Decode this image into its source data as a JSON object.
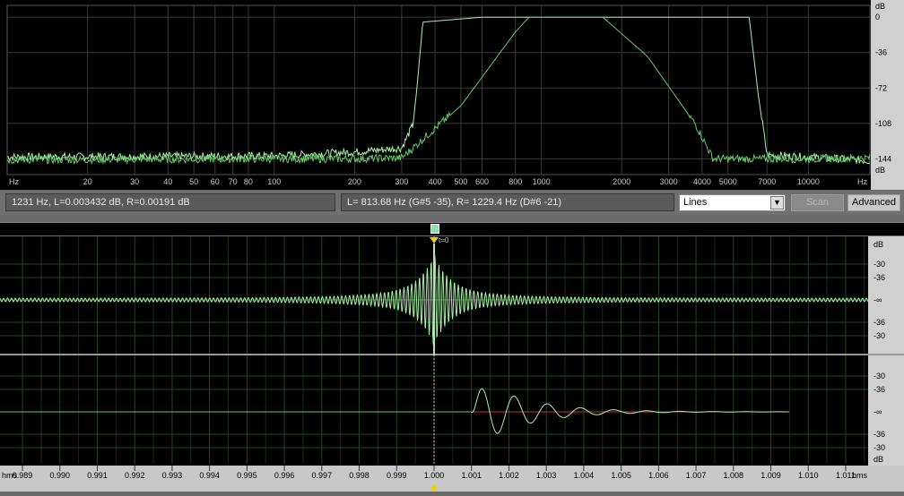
{
  "colors": {
    "background": "#000000",
    "grid": "#3a3a3a",
    "wave_grid": "#1e4a1e",
    "trace": "#a8f0a8",
    "trace_dim": "#66c866",
    "axis_panel": "#d0d0d0",
    "marker": "#f0d000",
    "red_line": "#c83030"
  },
  "spectrum": {
    "x_unit_left": "Hz",
    "x_unit_right": "Hz",
    "y_unit": "dB",
    "x_ticks": [
      {
        "label": "20",
        "v": 20
      },
      {
        "label": "30",
        "v": 30
      },
      {
        "label": "40",
        "v": 40
      },
      {
        "label": "50",
        "v": 50
      },
      {
        "label": "60",
        "v": 60
      },
      {
        "label": "70",
        "v": 70
      },
      {
        "label": "80",
        "v": 80
      },
      {
        "label": "100",
        "v": 100
      },
      {
        "label": "200",
        "v": 200
      },
      {
        "label": "300",
        "v": 300
      },
      {
        "label": "400",
        "v": 400
      },
      {
        "label": "500",
        "v": 500
      },
      {
        "label": "600",
        "v": 600
      },
      {
        "label": "800",
        "v": 800
      },
      {
        "label": "1000",
        "v": 1000
      },
      {
        "label": "2000",
        "v": 2000
      },
      {
        "label": "3000",
        "v": 3000
      },
      {
        "label": "4000",
        "v": 4000
      },
      {
        "label": "5000",
        "v": 5000
      },
      {
        "label": "7000",
        "v": 7000
      },
      {
        "label": "10000",
        "v": 10000
      }
    ],
    "y_ticks": [
      {
        "label": "0",
        "v": 0
      },
      {
        "label": "-36",
        "v": -36
      },
      {
        "label": "-72",
        "v": -72
      },
      {
        "label": "-108",
        "v": -108
      },
      {
        "label": "-144",
        "v": -144
      }
    ]
  },
  "chart_data": [
    {
      "type": "line",
      "xscale": "log",
      "xlim": [
        10,
        17000
      ],
      "ylim": [
        -160,
        12
      ],
      "xlabel": "Hz",
      "ylabel": "dB",
      "series": [
        {
          "values": [
            [
              10,
              -142
            ],
            [
              100,
              -141
            ],
            [
              200,
              -137
            ],
            [
              300,
              -133
            ],
            [
              330,
              -110
            ],
            [
              340,
              -80
            ],
            [
              360,
              -5
            ],
            [
              600,
              0
            ],
            [
              1500,
              0
            ],
            [
              6000,
              0
            ],
            [
              6500,
              -80
            ],
            [
              7000,
              -140
            ],
            [
              10000,
              -142
            ],
            [
              17000,
              -146
            ]
          ]
        },
        {
          "values": [
            [
              10,
              -145
            ],
            [
              100,
              -144
            ],
            [
              200,
              -144
            ],
            [
              300,
              -143
            ],
            [
              500,
              -90
            ],
            [
              800,
              -15
            ],
            [
              900,
              0
            ],
            [
              1700,
              0
            ],
            [
              2500,
              -40
            ],
            [
              3800,
              -110
            ],
            [
              4400,
              -144
            ],
            [
              10000,
              -144
            ],
            [
              17000,
              -143
            ]
          ]
        }
      ]
    },
    {
      "type": "line",
      "xlim": [
        0.9884,
        1.0116
      ],
      "xlabel": "hms",
      "ylabel": "dB"
    }
  ],
  "status": {
    "cursor": "1231 Hz, L=0.003432 dB, R=0.00191 dB",
    "markers": "L= 813.68 Hz (G#5 -35), R= 1229.4 Hz (D#6 -21)",
    "mode_value": "Lines",
    "scan_label": "Scan",
    "advanced_label": "Advanced"
  },
  "waveform": {
    "marker_label": "t=0",
    "y_unit": "dB",
    "x_unit_left": "hms",
    "x_unit_right": "hms",
    "y_ticks_top": [
      "-30",
      "-36",
      "-∞",
      "-36",
      "-30"
    ],
    "y_ticks_bottom": [
      "-30",
      "-36",
      "-∞",
      "-36",
      "-30"
    ],
    "bottom_unit": "dB",
    "x_ticks": [
      "0.989",
      "0.990",
      "0.991",
      "0.992",
      "0.993",
      "0.994",
      "0.995",
      "0.996",
      "0.997",
      "0.998",
      "0.999",
      "1.000",
      "1.001",
      "1.002",
      "1.003",
      "1.004",
      "1.005",
      "1.006",
      "1.007",
      "1.008",
      "1.009",
      "1.010",
      "1.011"
    ]
  }
}
